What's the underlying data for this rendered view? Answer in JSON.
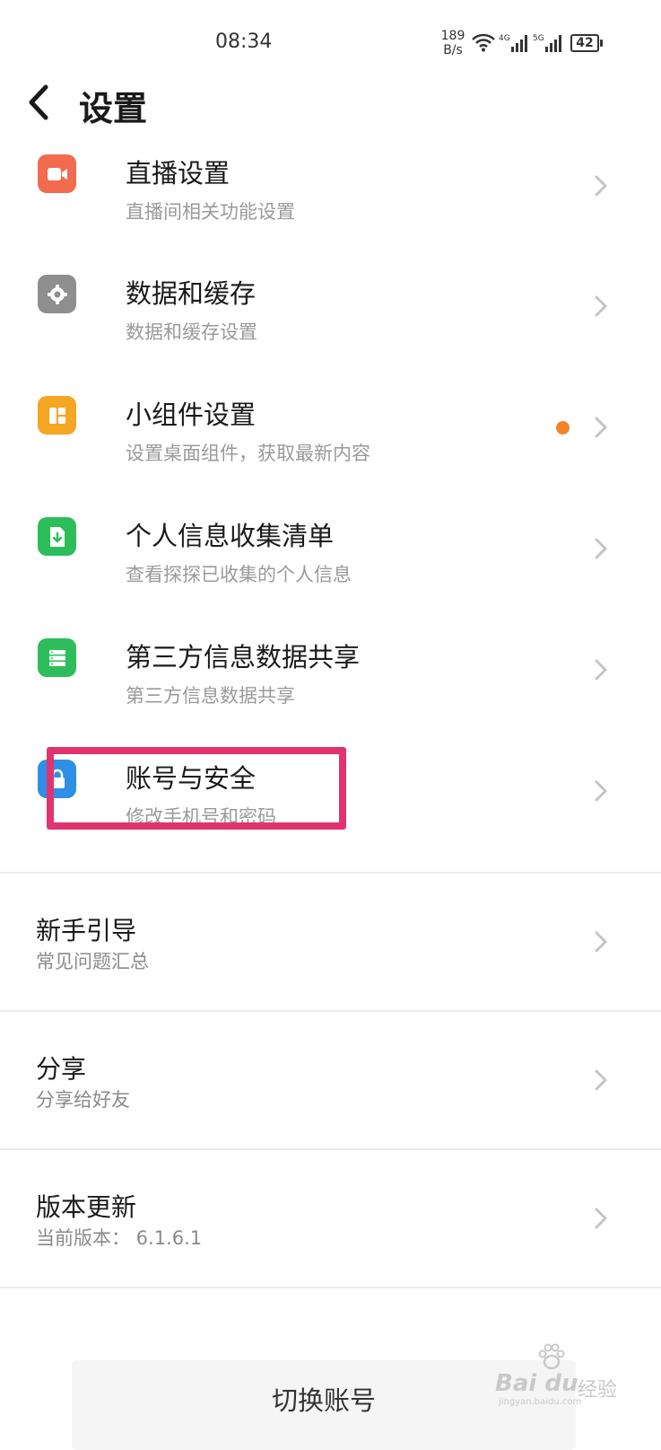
{
  "status_bar": {
    "time": "08:34",
    "net_speed_value": "189",
    "net_speed_unit": "B/s",
    "signal_1_label": "4G",
    "signal_2_label": "5G",
    "battery": "42"
  },
  "header": {
    "title": "设置"
  },
  "settings_items": [
    {
      "title": "直播设置",
      "subtitle": "直播间相关功能设置",
      "icon": "video-camera-icon",
      "color": "#f26b4f"
    },
    {
      "title": "数据和缓存",
      "subtitle": "数据和缓存设置",
      "icon": "gear-icon",
      "color": "#8e8e8e"
    },
    {
      "title": "小组件设置",
      "subtitle": "设置桌面组件，获取最新内容",
      "icon": "widget-icon",
      "color": "#f5a623",
      "badge_color": "#f5822a"
    },
    {
      "title": "个人信息收集清单",
      "subtitle": "查看探探已收集的个人信息",
      "icon": "file-download-icon",
      "color": "#2dbd5a"
    },
    {
      "title": "第三方信息数据共享",
      "subtitle": "第三方信息数据共享",
      "icon": "server-list-icon",
      "color": "#2dbd5a"
    },
    {
      "title": "账号与安全",
      "subtitle": "修改手机号和密码",
      "icon": "lock-icon",
      "color": "#2f8fe6"
    }
  ],
  "sections": [
    {
      "title": "新手引导",
      "subtitle": "常见问题汇总"
    },
    {
      "title": "分享",
      "subtitle": "分享给好友"
    },
    {
      "title": "版本更新",
      "subtitle": "当前版本： 6.1.6.1"
    }
  ],
  "bottom": {
    "switch_account_label": "切换账号"
  },
  "watermark": {
    "brand": "Bai du",
    "sub": "经验",
    "url": "jingyan.baidu.com"
  },
  "colors": {
    "highlight": "#e0336f",
    "chevron": "#c4c4c4"
  }
}
